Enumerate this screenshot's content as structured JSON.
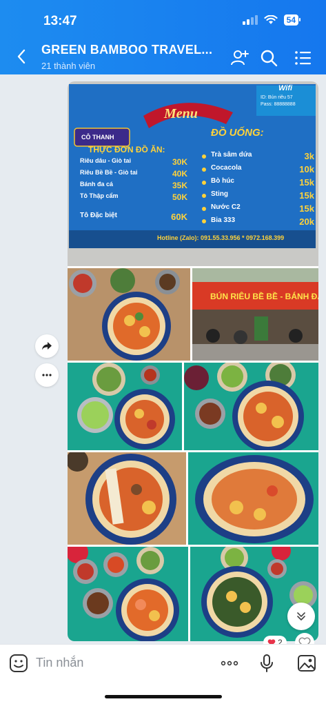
{
  "status": {
    "time": "13:47",
    "battery": "54"
  },
  "header": {
    "title": "GREEN BAMBOO TRAVEL...",
    "subtitle": "21 thành viên"
  },
  "menu_board": {
    "heading": "Menu",
    "brand": "CÔ THANH",
    "wifi_label": "Wifi",
    "wifi_id": "ID: Bún riêu 57",
    "wifi_pass": "Pass: 88888888",
    "food_title": "THỰC ĐƠN ĐỒ ĂN:",
    "food_items": [
      {
        "name": "Riêu dâu - Giò tai",
        "price": "30K"
      },
      {
        "name": "Riêu Bề Bề - Giò tai",
        "price": "40K"
      },
      {
        "name": "Bánh đa cá",
        "price": "35K"
      },
      {
        "name": "Tô Thập cẩm",
        "price": "50K"
      },
      {
        "name": "Tô Đặc biệt",
        "price": "60K"
      }
    ],
    "drink_title": "ĐỒ UỐNG:",
    "drink_items": [
      {
        "name": "Trà sâm dứa",
        "price": "3k"
      },
      {
        "name": "Cocacola",
        "price": "10k"
      },
      {
        "name": "Bò húc",
        "price": "15k"
      },
      {
        "name": "Sting",
        "price": "15k"
      },
      {
        "name": "Nước C2",
        "price": "15k"
      },
      {
        "name": "Bia 333",
        "price": "20k"
      }
    ],
    "hotline": "Hotline (Zalo): 091.55.33.956  *  0972.168.399"
  },
  "storefront": {
    "sign": "BÚN RIÊU BỀ BỀ - BÁNH ĐA CÁ"
  },
  "reaction": {
    "count": "2"
  },
  "composer": {
    "placeholder": "Tin nhắn"
  },
  "colors": {
    "header": "#1577ee",
    "board": "#1f6fc4",
    "teal_table": "#1aa58f"
  }
}
